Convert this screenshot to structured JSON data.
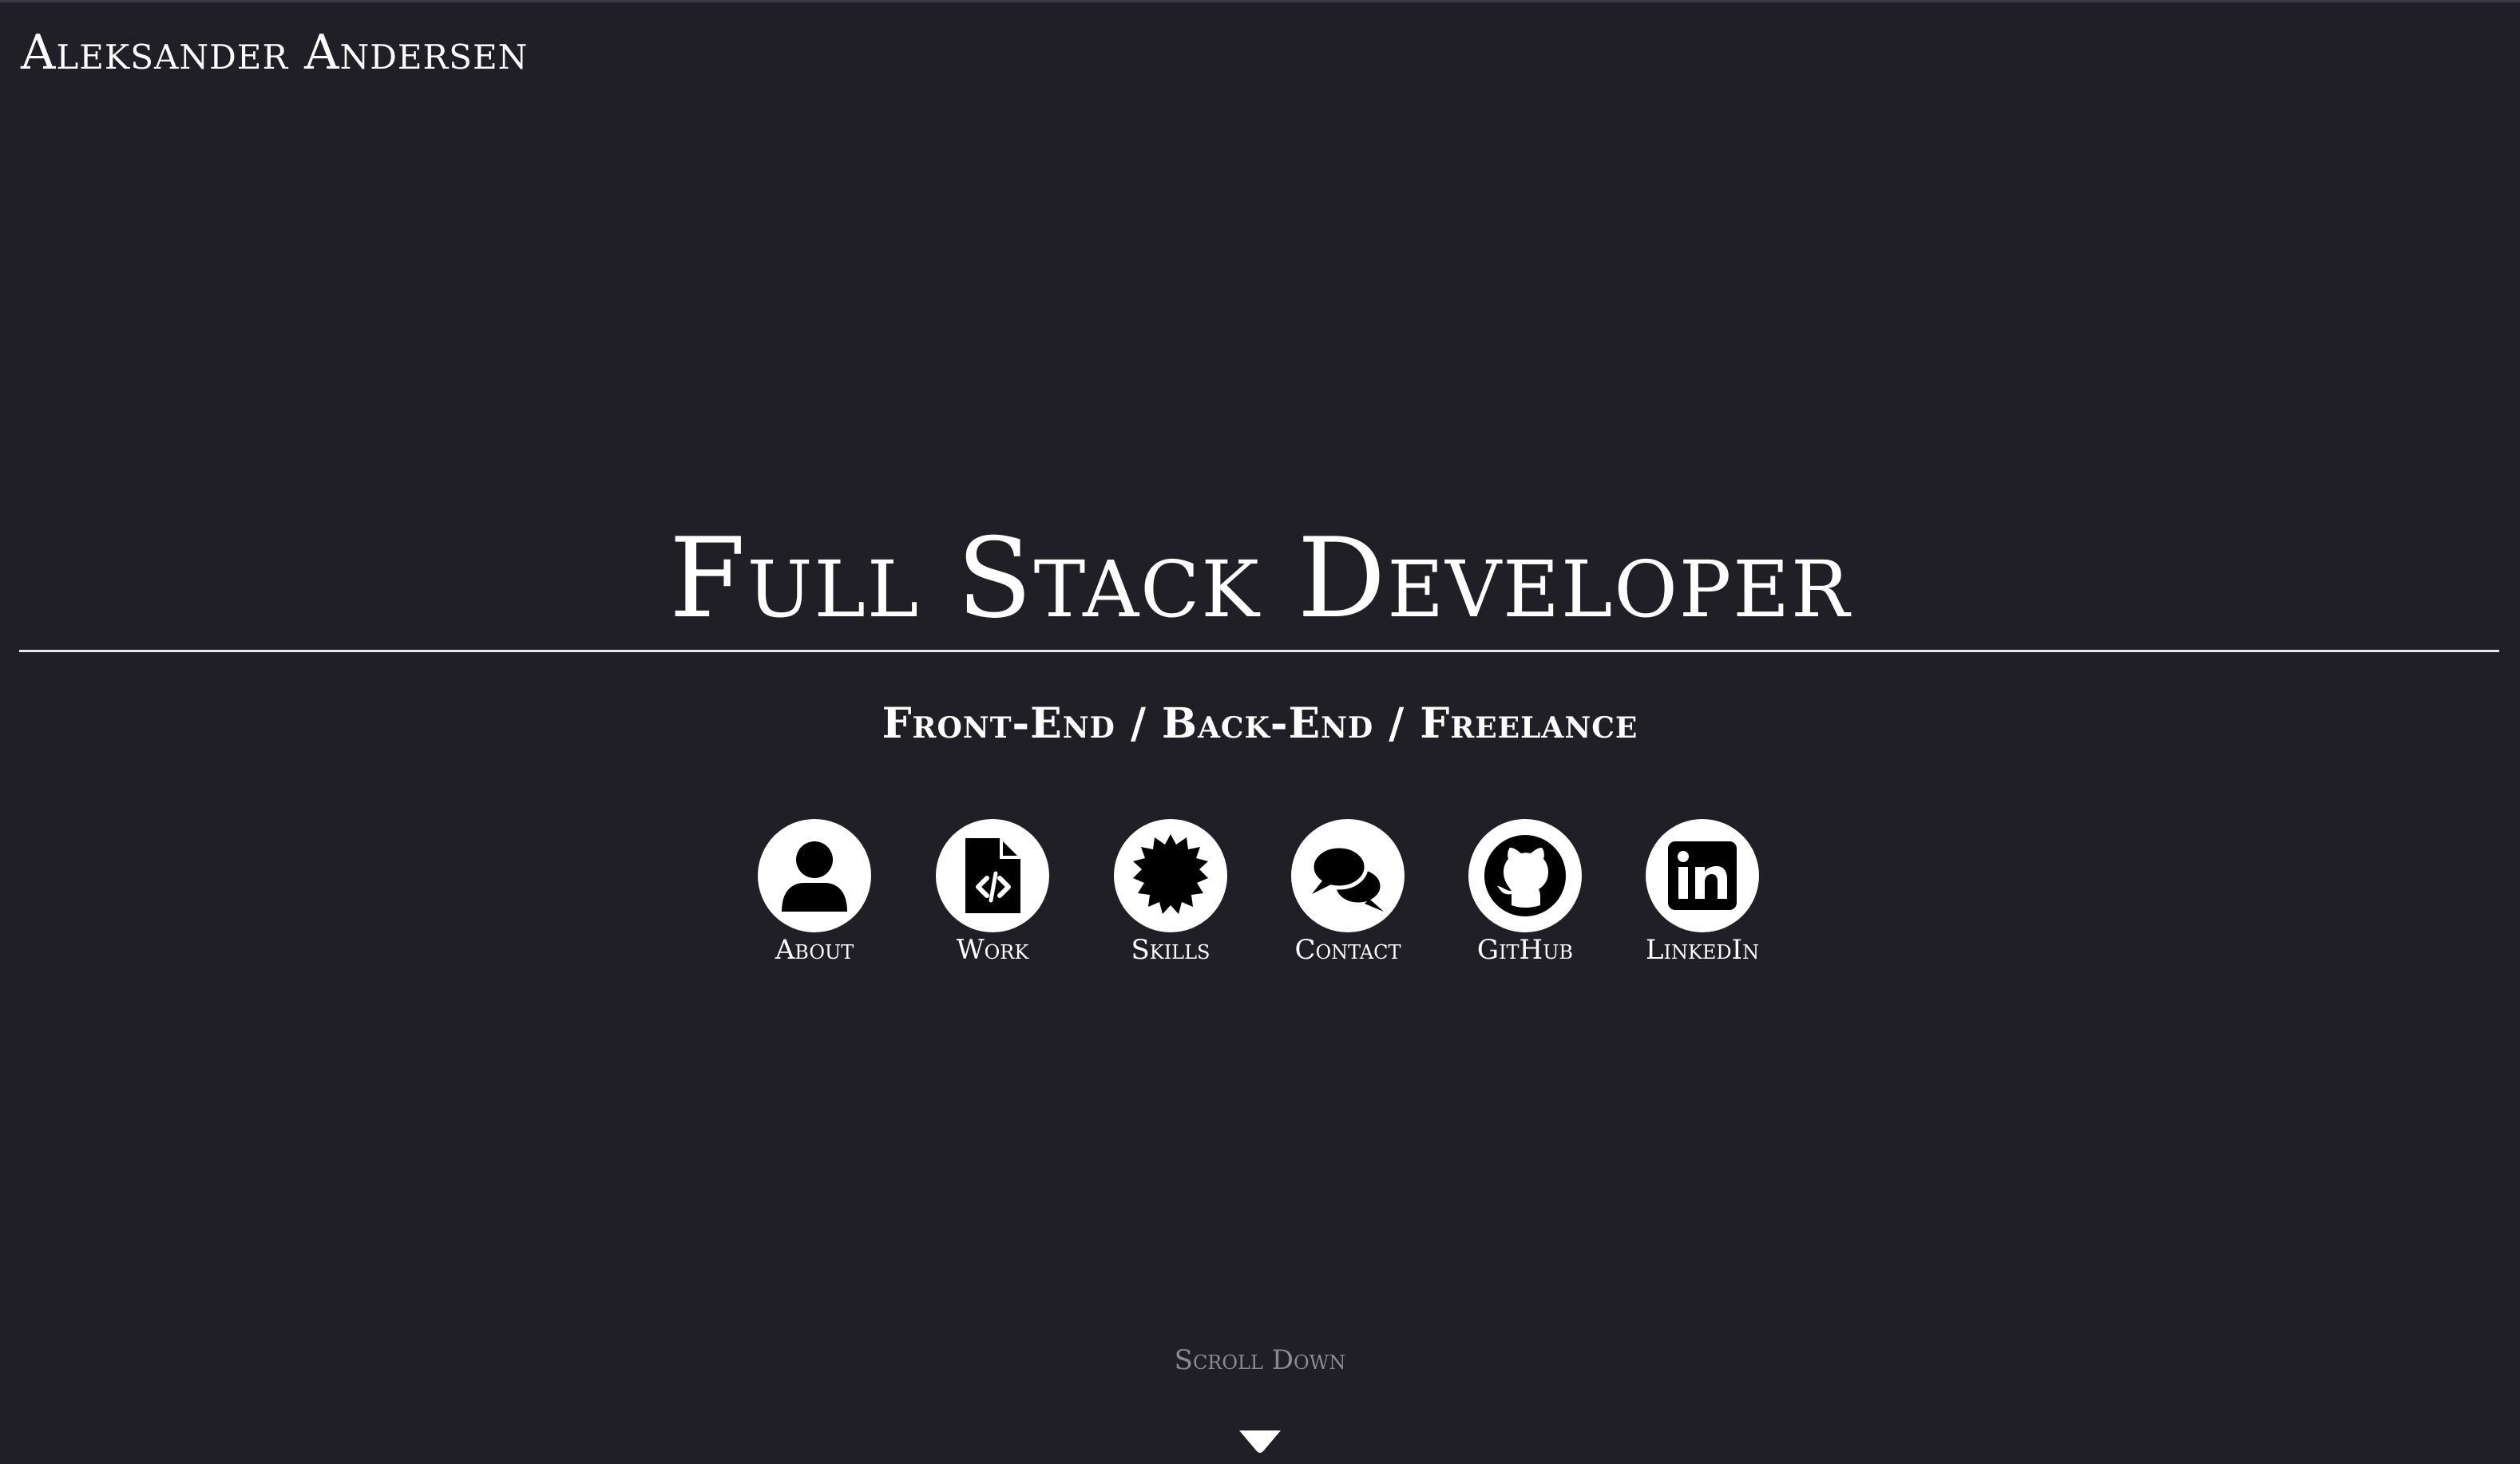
{
  "header": {
    "brand": "Aleksander Andersen"
  },
  "hero": {
    "title": "Full Stack Developer",
    "subtitle": "Front-End / Back-End / Freelance"
  },
  "nav": [
    {
      "label": "About",
      "icon": "user-icon"
    },
    {
      "label": "Work",
      "icon": "code-file-icon"
    },
    {
      "label": "Skills",
      "icon": "badge-icon"
    },
    {
      "label": "Contact",
      "icon": "chat-bubbles-icon"
    },
    {
      "label": "GitHub",
      "icon": "github-icon"
    },
    {
      "label": "LinkedIn",
      "icon": "linkedin-icon"
    }
  ],
  "scroll": {
    "label": "Scroll Down",
    "icon": "caret-down-icon"
  },
  "colors": {
    "background": "#1f1f25",
    "foreground": "#ffffff",
    "muted": "#8a8a8f"
  }
}
